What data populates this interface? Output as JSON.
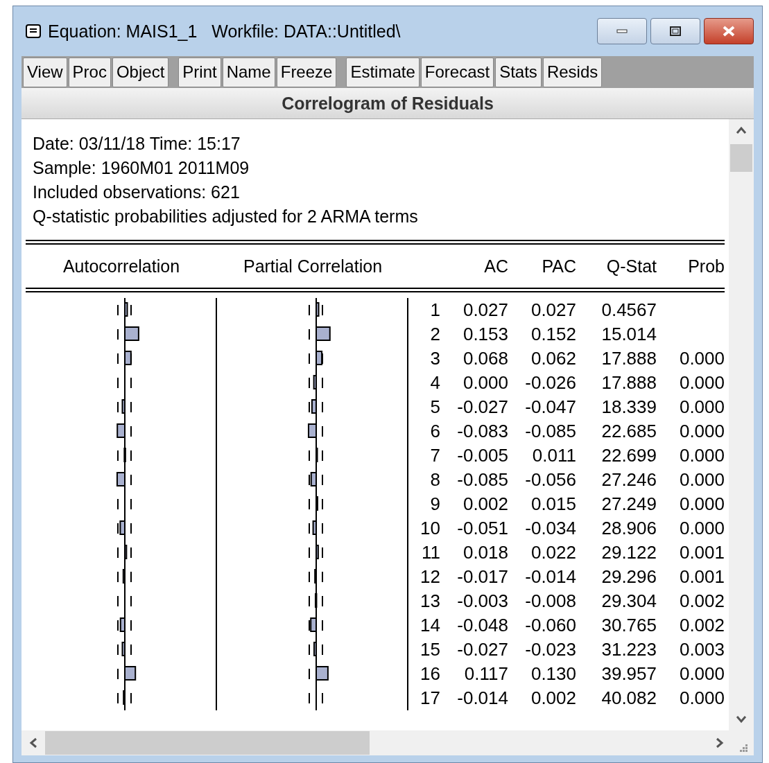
{
  "window": {
    "title": "Equation: MAIS1_1   Workfile: DATA::Untitled\\"
  },
  "toolbar": {
    "groups": [
      [
        "View",
        "Proc",
        "Object"
      ],
      [
        "Print",
        "Name",
        "Freeze"
      ],
      [
        "Estimate",
        "Forecast",
        "Stats",
        "Resids"
      ]
    ]
  },
  "view_title": "Correlogram of Residuals",
  "info": [
    "Date: 03/11/18   Time: 15:17",
    "Sample: 1960M01 2011M09",
    "Included observations: 621",
    "Q-statistic probabilities adjusted for 2 ARMA terms"
  ],
  "table": {
    "columns": [
      "Autocorrelation",
      "Partial Correlation",
      "AC",
      "PAC",
      "Q-Stat",
      "Prob"
    ],
    "rows": [
      {
        "lag": "1",
        "ac": "0.027",
        "pac": "0.027",
        "q_stat": "0.4567"
      },
      {
        "lag": "2",
        "ac": "0.153",
        "pac": "0.152",
        "q_stat": "15.014"
      },
      {
        "lag": "3",
        "ac": "0.068",
        "pac": "0.062",
        "q_stat": "17.888",
        "prob": "0.000"
      },
      {
        "lag": "4",
        "ac": "0.000",
        "pac": "-0.026",
        "q_stat": "17.888",
        "prob": "0.000"
      },
      {
        "lag": "5",
        "ac": "-0.027",
        "pac": "-0.047",
        "q_stat": "18.339",
        "prob": "0.000"
      },
      {
        "lag": "6",
        "ac": "-0.083",
        "pac": "-0.085",
        "q_stat": "22.685",
        "prob": "0.000"
      },
      {
        "lag": "7",
        "ac": "-0.005",
        "pac": "0.011",
        "q_stat": "22.699",
        "prob": "0.000"
      },
      {
        "lag": "8",
        "ac": "-0.085",
        "pac": "-0.056",
        "q_stat": "27.246",
        "prob": "0.000"
      },
      {
        "lag": "9",
        "ac": "0.002",
        "pac": "0.015",
        "q_stat": "27.249",
        "prob": "0.000"
      },
      {
        "lag": "10",
        "ac": "-0.051",
        "pac": "-0.034",
        "q_stat": "28.906",
        "prob": "0.000"
      },
      {
        "lag": "11",
        "ac": "0.018",
        "pac": "0.022",
        "q_stat": "29.122",
        "prob": "0.001"
      },
      {
        "lag": "12",
        "ac": "-0.017",
        "pac": "-0.014",
        "q_stat": "29.296",
        "prob": "0.001"
      },
      {
        "lag": "13",
        "ac": "-0.003",
        "pac": "-0.008",
        "q_stat": "29.304",
        "prob": "0.002"
      },
      {
        "lag": "14",
        "ac": "-0.048",
        "pac": "-0.060",
        "q_stat": "30.765",
        "prob": "0.002"
      },
      {
        "lag": "15",
        "ac": "-0.027",
        "pac": "-0.023",
        "q_stat": "31.223",
        "prob": "0.003"
      },
      {
        "lag": "16",
        "ac": "0.117",
        "pac": "0.130",
        "q_stat": "39.957",
        "prob": "0.000"
      },
      {
        "lag": "17",
        "ac": "-0.014",
        "pac": "0.002",
        "q_stat": "40.082",
        "prob": "0.000"
      }
    ]
  }
}
